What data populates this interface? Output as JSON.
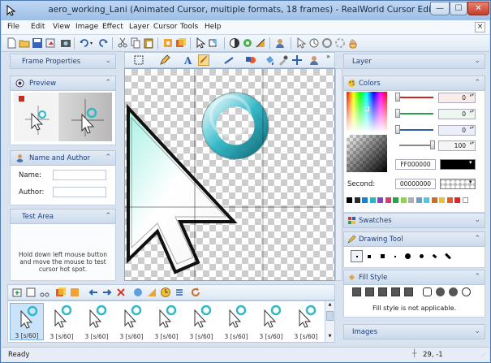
{
  "window": {
    "title": "aero_working_Lani (Animated Cursor, multiple formats, 18 frames) - RealWorld Cursor Editor",
    "min_glyph": "—",
    "max_glyph": "☐",
    "close_glyph": "✕"
  },
  "menu": {
    "items": [
      "File",
      "Edit",
      "View",
      "Image",
      "Effect",
      "Layer",
      "Cursor",
      "Tools",
      "Help"
    ],
    "close_glyph": "×"
  },
  "left_panel": {
    "frame_properties": "Frame Properties",
    "preview": "Preview",
    "name_author": "Name and Author",
    "name_label": "Name:",
    "author_label": "Author:",
    "name_value": "",
    "author_value": "",
    "test_area": "Test Area",
    "test_instructions": "Hold down left mouse button and move the mouse to test cursor hot spot."
  },
  "right_panel": {
    "layer": "Layer",
    "colors": "Colors",
    "red_value": "0",
    "green_value": "0",
    "blue_value": "0",
    "alpha_value": "100",
    "hex_value": "FF000000",
    "second_label": "Second:",
    "second_value": "00000000",
    "swatches": "Swatches",
    "drawing_tool": "Drawing Tool",
    "fill_style": "Fill Style",
    "fill_message": "Fill style is not applicable.",
    "images": "Images",
    "palette": [
      "#000000",
      "#2b2b2b",
      "#1c7fd6",
      "#29b7c4",
      "#8a3fcf",
      "#e0357b",
      "#2ea04a",
      "#8fd24f",
      "#b0b0b0",
      "#6d9ec8",
      "#5bc3df",
      "#c96e2d",
      "#e9c138",
      "#e85a2a",
      "#d52b2b",
      "#ffffff"
    ]
  },
  "frames": {
    "labels": [
      "3 [s/60]",
      "3 [s/60]",
      "3 [s/60]",
      "3 [s/60]",
      "3 [s/60]",
      "3 [s/60]",
      "3 [s/60]",
      "3 [s/60]",
      "3 [s/60]"
    ]
  },
  "status": {
    "text": "Ready",
    "coords": "29, -1"
  },
  "colors": {
    "accent": "#1e3f7a",
    "panel_header": "#cbdaec",
    "teal": "#2fb8c8"
  }
}
